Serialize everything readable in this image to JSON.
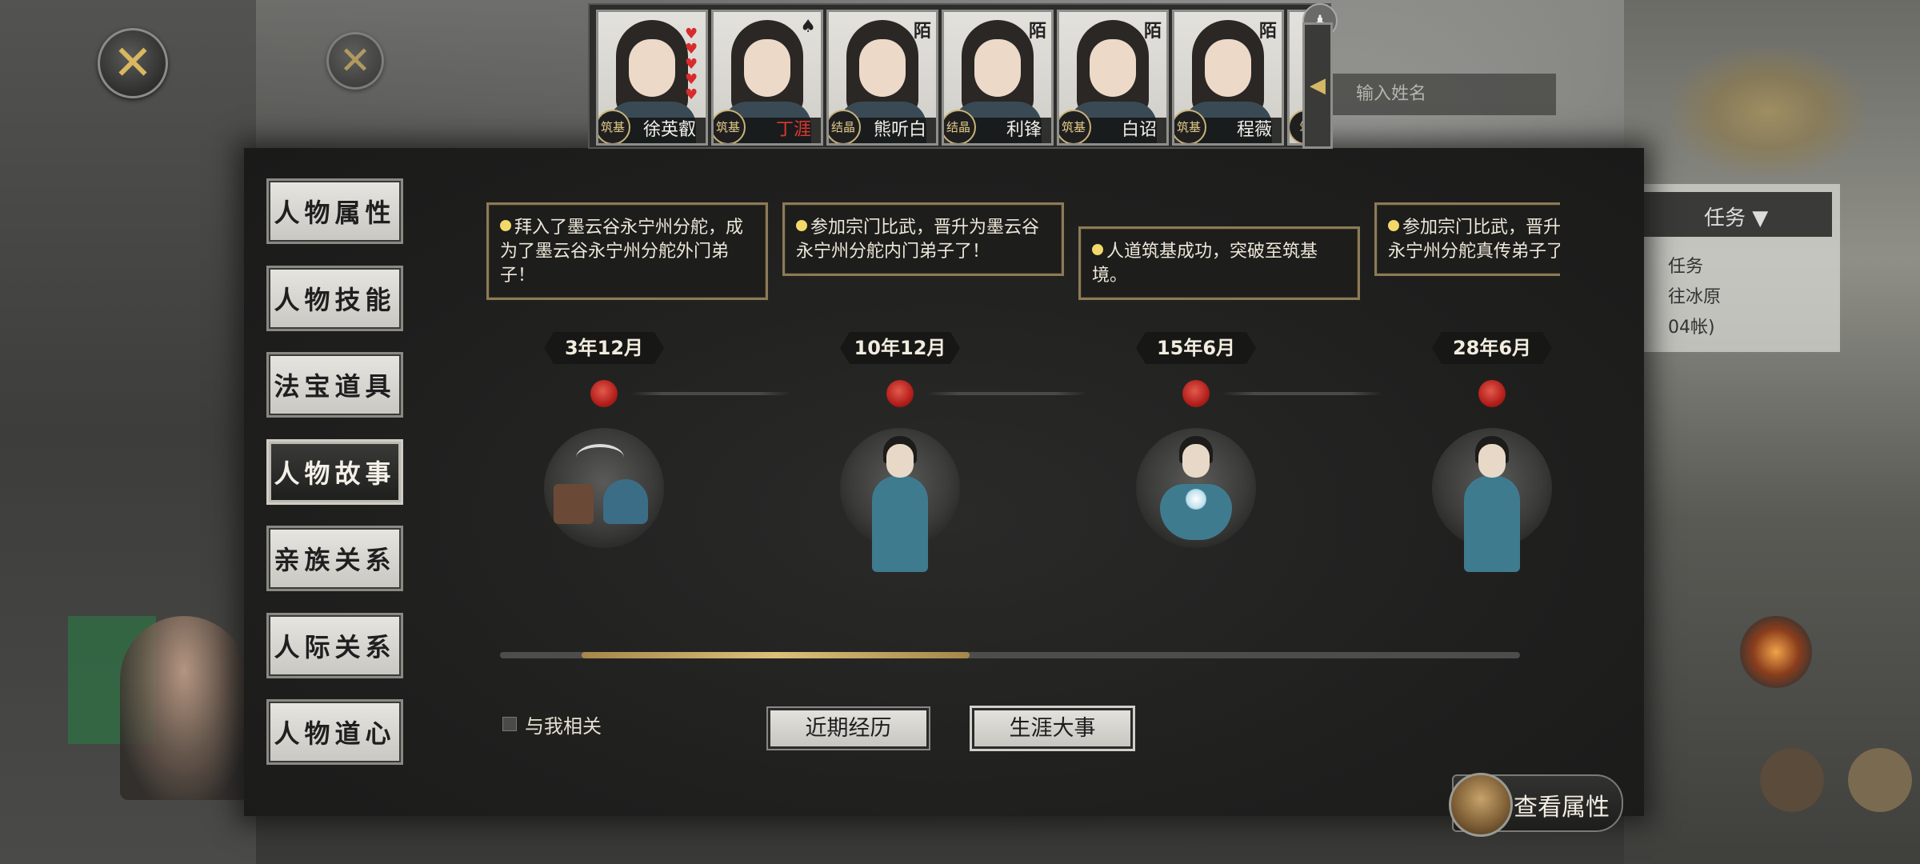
{
  "close_buttons": {
    "primary": "✕",
    "secondary": "✕"
  },
  "character_bar": {
    "characters": [
      {
        "name": "徐英叡",
        "rank": "筑基",
        "highlighted": false,
        "tag": "",
        "hearts": 5
      },
      {
        "name": "丁涯",
        "rank": "筑基",
        "highlighted": true,
        "tag": "♠",
        "hearts": 0
      },
      {
        "name": "熊听白",
        "rank": "结晶",
        "highlighted": false,
        "tag": "陌",
        "hearts": 0
      },
      {
        "name": "利锋",
        "rank": "结晶",
        "highlighted": false,
        "tag": "陌",
        "hearts": 0
      },
      {
        "name": "白诏",
        "rank": "筑基",
        "highlighted": false,
        "tag": "陌",
        "hearts": 0
      },
      {
        "name": "程薇",
        "rank": "筑基",
        "highlighted": false,
        "tag": "陌",
        "hearts": 0
      }
    ],
    "partial_rank": "筑",
    "toggle_icon": "◀"
  },
  "background": {
    "search_placeholder": "输入姓名",
    "mission_label": "任务 ▼",
    "mission_items": [
      "任务",
      "往冰原",
      "04帐)"
    ]
  },
  "side_tabs": [
    "人物属性",
    "人物技能",
    "法宝道具",
    "人物故事",
    "亲族关系",
    "人际关系",
    "人物道心"
  ],
  "active_tab": "人物故事",
  "story": {
    "events": [
      {
        "text": "拜入了墨云谷永宁州分舵，成为了墨云谷永宁州分舵外门弟子！",
        "date": "3年12月",
        "image": "objects"
      },
      {
        "text": "参加宗门比武，晋升为墨云谷永宁州分舵内门弟子了！",
        "date": "10年12月",
        "image": "standing"
      },
      {
        "text": "人道筑基成功，突破至筑基境。",
        "date": "15年6月",
        "image": "sitting"
      },
      {
        "text": "参加宗门比武，晋升为墨云谷永宁州分舵真传弟子了！",
        "date": "28年6月",
        "image": "standing"
      }
    ]
  },
  "timeline_scroll": {
    "start_fraction": 0.08,
    "end_fraction": 0.46
  },
  "filters": {
    "related_checkbox_label": "与我相关",
    "recent_label": "近期经历",
    "career_label": "生涯大事",
    "selected": "career"
  },
  "view_attributes_label": "查看属性",
  "colors": {
    "accent_gold": "#d9b760",
    "seal_red": "#c0261f",
    "highlight_name": "#e0382e"
  }
}
